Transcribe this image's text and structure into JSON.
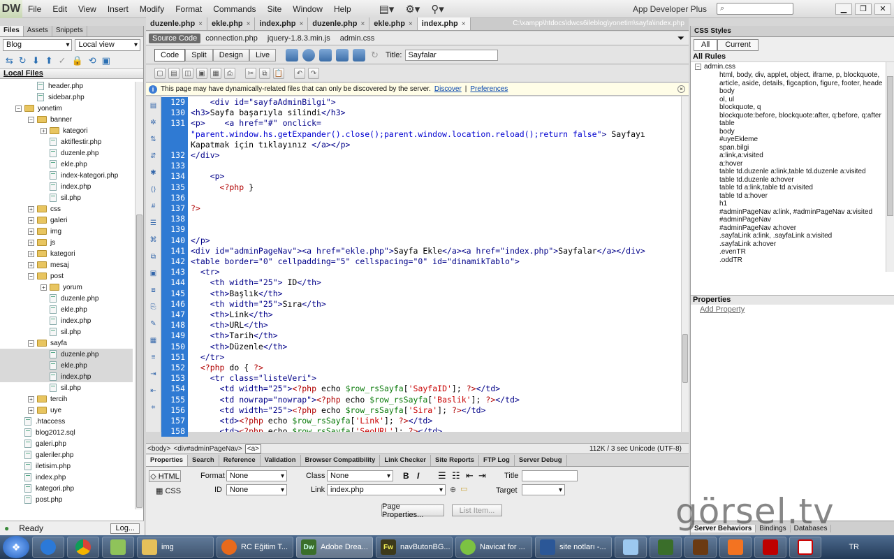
{
  "menubar": {
    "logo": "DW",
    "items": [
      "File",
      "Edit",
      "View",
      "Insert",
      "Modify",
      "Format",
      "Commands",
      "Site",
      "Window",
      "Help"
    ],
    "workspace": "App Developer Plus"
  },
  "files_panel": {
    "tabs": [
      "Files",
      "Assets",
      "Snippets"
    ],
    "site_select": "Blog",
    "view_select": "Local view",
    "header": "Local Files",
    "tree": [
      {
        "label": "header.php",
        "depth": 2,
        "type": "file"
      },
      {
        "label": "sidebar.php",
        "depth": 2,
        "type": "file"
      },
      {
        "label": "yonetim",
        "depth": 1,
        "type": "folder",
        "exp": "−"
      },
      {
        "label": "banner",
        "depth": 2,
        "type": "folder",
        "exp": "−"
      },
      {
        "label": "kategori",
        "depth": 3,
        "type": "folder",
        "exp": "+"
      },
      {
        "label": "aktiflestir.php",
        "depth": 3,
        "type": "file"
      },
      {
        "label": "duzenle.php",
        "depth": 3,
        "type": "file"
      },
      {
        "label": "ekle.php",
        "depth": 3,
        "type": "file"
      },
      {
        "label": "index-kategori.php",
        "depth": 3,
        "type": "file"
      },
      {
        "label": "index.php",
        "depth": 3,
        "type": "file"
      },
      {
        "label": "sil.php",
        "depth": 3,
        "type": "file"
      },
      {
        "label": "css",
        "depth": 2,
        "type": "folder",
        "exp": "+"
      },
      {
        "label": "galeri",
        "depth": 2,
        "type": "folder",
        "exp": "+"
      },
      {
        "label": "img",
        "depth": 2,
        "type": "folder",
        "exp": "+"
      },
      {
        "label": "js",
        "depth": 2,
        "type": "folder",
        "exp": "+"
      },
      {
        "label": "kategori",
        "depth": 2,
        "type": "folder",
        "exp": "+"
      },
      {
        "label": "mesaj",
        "depth": 2,
        "type": "folder",
        "exp": "+"
      },
      {
        "label": "post",
        "depth": 2,
        "type": "folder",
        "exp": "−"
      },
      {
        "label": "yorum",
        "depth": 3,
        "type": "folder",
        "exp": "+"
      },
      {
        "label": "duzenle.php",
        "depth": 3,
        "type": "file"
      },
      {
        "label": "ekle.php",
        "depth": 3,
        "type": "file"
      },
      {
        "label": "index.php",
        "depth": 3,
        "type": "file"
      },
      {
        "label": "sil.php",
        "depth": 3,
        "type": "file"
      },
      {
        "label": "sayfa",
        "depth": 2,
        "type": "folder",
        "exp": "−"
      },
      {
        "label": "duzenle.php",
        "depth": 3,
        "type": "file",
        "selected": true
      },
      {
        "label": "ekle.php",
        "depth": 3,
        "type": "file",
        "selected": true
      },
      {
        "label": "index.php",
        "depth": 3,
        "type": "file",
        "selected": true
      },
      {
        "label": "sil.php",
        "depth": 3,
        "type": "file"
      },
      {
        "label": "tercih",
        "depth": 2,
        "type": "folder",
        "exp": "+"
      },
      {
        "label": "uye",
        "depth": 2,
        "type": "folder",
        "exp": "+"
      },
      {
        "label": ".htaccess",
        "depth": 1,
        "type": "file"
      },
      {
        "label": "blog2012.sql",
        "depth": 1,
        "type": "file"
      },
      {
        "label": "galeri.php",
        "depth": 1,
        "type": "file"
      },
      {
        "label": "galeriler.php",
        "depth": 1,
        "type": "file"
      },
      {
        "label": "iletisim.php",
        "depth": 1,
        "type": "file"
      },
      {
        "label": "index.php",
        "depth": 1,
        "type": "file"
      },
      {
        "label": "kategori.php",
        "depth": 1,
        "type": "file"
      },
      {
        "label": "post.php",
        "depth": 1,
        "type": "file"
      }
    ],
    "status": "Ready",
    "log_button": "Log..."
  },
  "doc_tabs": [
    "duzenle.php",
    "ekle.php",
    "index.php",
    "duzenle.php",
    "ekle.php",
    "index.php"
  ],
  "doc_path": "C:\\xampp\\htdocs\\dwcs6ileblog\\yonetim\\sayfa\\index.php",
  "related_files": [
    "Source Code",
    "connection.php",
    "jquery-1.8.3.min.js",
    "admin.css"
  ],
  "view_buttons": [
    "Code",
    "Split",
    "Design",
    "Live"
  ],
  "title_label": "Title:",
  "title_value": "Sayfalar",
  "infobar": {
    "text": "This page may have dynamically-related files that can only be discovered by the server.",
    "discover": "Discover",
    "sep": "|",
    "preferences": "Preferences"
  },
  "code_lines": [
    {
      "n": "129",
      "hl": true,
      "parts": [
        [
          "tag",
          "    <div id=\"sayfaAdminBilgi\">"
        ]
      ]
    },
    {
      "n": "130",
      "hl": true,
      "parts": [
        [
          "tag",
          "<h3>"
        ],
        [
          "txt",
          "Sayfa başarıyla silindi"
        ],
        [
          "tag",
          "</h3>"
        ]
      ]
    },
    {
      "n": "131",
      "hl": true,
      "parts": [
        [
          "tag",
          "<p>"
        ],
        [
          "txt",
          "    "
        ],
        [
          "tag",
          "<a href=\"#\" onclick="
        ]
      ]
    },
    {
      "n": "",
      "hl": true,
      "parts": [
        [
          "val",
          "\"parent.window.hs.getExpander().close();parent.window.location.reload();return false\""
        ],
        [
          "tag",
          ">"
        ],
        [
          "txt",
          " Sayfayı"
        ]
      ]
    },
    {
      "n": "",
      "hl": true,
      "parts": [
        [
          "txt",
          "Kapatmak için tıklayınız "
        ],
        [
          "tag",
          "</a></p>"
        ]
      ]
    },
    {
      "n": "132",
      "hl": true,
      "parts": [
        [
          "tag",
          "</div>"
        ]
      ]
    },
    {
      "n": "133",
      "hl": true,
      "parts": [
        [
          "txt",
          ""
        ]
      ]
    },
    {
      "n": "134",
      "hl": true,
      "parts": [
        [
          "tag",
          "    <p>"
        ]
      ]
    },
    {
      "n": "135",
      "hl": true,
      "parts": [
        [
          "php",
          "      <?php "
        ],
        [
          "txt",
          "}"
        ]
      ]
    },
    {
      "n": "136",
      "hl": true,
      "parts": [
        [
          "txt",
          ""
        ]
      ]
    },
    {
      "n": "137",
      "hl": true,
      "parts": [
        [
          "php",
          "?>"
        ]
      ]
    },
    {
      "n": "138",
      "hl": true,
      "parts": [
        [
          "txt",
          ""
        ]
      ]
    },
    {
      "n": "139",
      "hl": true,
      "parts": [
        [
          "txt",
          ""
        ]
      ]
    },
    {
      "n": "140",
      "hl": true,
      "parts": [
        [
          "tag",
          "</p>"
        ]
      ]
    },
    {
      "n": "141",
      "hl": true,
      "parts": [
        [
          "tag",
          "<div id=\"adminPageNav\"><a href=\"ekle.php\">"
        ],
        [
          "txt",
          "Sayfa Ekle"
        ],
        [
          "tag",
          "</a><a href=\"index.php\">"
        ],
        [
          "txt",
          "Sayfalar"
        ],
        [
          "tag",
          "</a></div>"
        ]
      ]
    },
    {
      "n": "142",
      "hl": true,
      "parts": [
        [
          "tag",
          "<table border=\"0\" cellpadding=\"5\" cellspacing=\"0\" id=\"dinamikTablo\">"
        ]
      ]
    },
    {
      "n": "143",
      "hl": true,
      "parts": [
        [
          "tag",
          "  <tr>"
        ]
      ]
    },
    {
      "n": "144",
      "hl": true,
      "parts": [
        [
          "tag",
          "    <th width=\"25\">"
        ],
        [
          "txt",
          " ID"
        ],
        [
          "tag",
          "</th>"
        ]
      ]
    },
    {
      "n": "145",
      "hl": true,
      "parts": [
        [
          "tag",
          "    <th>"
        ],
        [
          "txt",
          "Başlık"
        ],
        [
          "tag",
          "</th>"
        ]
      ]
    },
    {
      "n": "146",
      "hl": true,
      "parts": [
        [
          "tag",
          "    <th width=\"25\">"
        ],
        [
          "txt",
          "Sıra"
        ],
        [
          "tag",
          "</th>"
        ]
      ]
    },
    {
      "n": "147",
      "hl": true,
      "parts": [
        [
          "tag",
          "    <th>"
        ],
        [
          "txt",
          "Link"
        ],
        [
          "tag",
          "</th>"
        ]
      ]
    },
    {
      "n": "148",
      "hl": true,
      "parts": [
        [
          "tag",
          "    <th>"
        ],
        [
          "txt",
          "URL"
        ],
        [
          "tag",
          "</th>"
        ]
      ]
    },
    {
      "n": "149",
      "hl": true,
      "parts": [
        [
          "tag",
          "    <th>"
        ],
        [
          "txt",
          "Tarih"
        ],
        [
          "tag",
          "</th>"
        ]
      ]
    },
    {
      "n": "150",
      "hl": true,
      "parts": [
        [
          "tag",
          "    <th>"
        ],
        [
          "txt",
          "Düzenle"
        ],
        [
          "tag",
          "</th>"
        ]
      ]
    },
    {
      "n": "151",
      "hl": true,
      "parts": [
        [
          "tag",
          "  </tr>"
        ]
      ]
    },
    {
      "n": "152",
      "hl": true,
      "parts": [
        [
          "php",
          "  <?php "
        ],
        [
          "txt",
          "do { "
        ],
        [
          "php",
          "?>"
        ]
      ]
    },
    {
      "n": "153",
      "hl": true,
      "parts": [
        [
          "tag",
          "    <tr class=\"listeVeri\">"
        ]
      ]
    },
    {
      "n": "154",
      "hl": true,
      "parts": [
        [
          "tag",
          "      <td width=\"25\">"
        ],
        [
          "php",
          "<?php "
        ],
        [
          "txt",
          "echo "
        ],
        [
          "var",
          "$row_rsSayfa"
        ],
        [
          "txt",
          "["
        ],
        [
          "str",
          "'SayfaID'"
        ],
        [
          "txt",
          "]; "
        ],
        [
          "php",
          "?>"
        ],
        [
          "tag",
          "</td>"
        ]
      ]
    },
    {
      "n": "155",
      "hl": true,
      "parts": [
        [
          "tag",
          "      <td nowrap=\"nowrap\">"
        ],
        [
          "php",
          "<?php "
        ],
        [
          "txt",
          "echo "
        ],
        [
          "var",
          "$row_rsSayfa"
        ],
        [
          "txt",
          "["
        ],
        [
          "str",
          "'Baslik'"
        ],
        [
          "txt",
          "]; "
        ],
        [
          "php",
          "?>"
        ],
        [
          "tag",
          "</td>"
        ]
      ]
    },
    {
      "n": "156",
      "hl": true,
      "parts": [
        [
          "tag",
          "      <td width=\"25\">"
        ],
        [
          "php",
          "<?php "
        ],
        [
          "txt",
          "echo "
        ],
        [
          "var",
          "$row_rsSayfa"
        ],
        [
          "txt",
          "["
        ],
        [
          "str",
          "'Sira'"
        ],
        [
          "txt",
          "]; "
        ],
        [
          "php",
          "?>"
        ],
        [
          "tag",
          "</td>"
        ]
      ]
    },
    {
      "n": "157",
      "hl": true,
      "parts": [
        [
          "tag",
          "      <td>"
        ],
        [
          "php",
          "<?php "
        ],
        [
          "txt",
          "echo "
        ],
        [
          "var",
          "$row_rsSayfa"
        ],
        [
          "txt",
          "["
        ],
        [
          "str",
          "'Link'"
        ],
        [
          "txt",
          "]; "
        ],
        [
          "php",
          "?>"
        ],
        [
          "tag",
          "</td>"
        ]
      ]
    },
    {
      "n": "158",
      "hl": true,
      "parts": [
        [
          "tag",
          "      <td>"
        ],
        [
          "php",
          "<?php "
        ],
        [
          "txt",
          "echo "
        ],
        [
          "var",
          "$row_rsSayfa"
        ],
        [
          "txt",
          "["
        ],
        [
          "str",
          "'SeoURL'"
        ],
        [
          "txt",
          "]; "
        ],
        [
          "php",
          "?>"
        ],
        [
          "tag",
          "</td>"
        ]
      ]
    }
  ],
  "status_bar": {
    "tags": [
      "<body>",
      "<div#adminPageNav>",
      "<a>"
    ],
    "info": "112K / 3 sec  Unicode (UTF-8)"
  },
  "prop_tabs": [
    "Properties",
    "Search",
    "Reference",
    "Validation",
    "Browser Compatibility",
    "Link Checker",
    "Site Reports",
    "FTP Log",
    "Server Debug"
  ],
  "properties": {
    "html_btn": "HTML",
    "css_btn": "CSS",
    "format_label": "Format",
    "format_value": "None",
    "id_label": "ID",
    "id_value": "None",
    "class_label": "Class",
    "class_value": "None",
    "link_label": "Link",
    "link_value": "index.php",
    "title_label": "Title",
    "target_label": "Target",
    "bold": "B",
    "italic": "I",
    "page_props": "Page Properties...",
    "list_item": "List Item..."
  },
  "css_panel": {
    "title": "CSS Styles",
    "tabs": [
      "All",
      "Current"
    ],
    "all_rules": "All Rules",
    "sheet": "admin.css",
    "rules": [
      "html, body, div, applet, object, iframe, p, blockquote,",
      "article, aside, details, figcaption, figure, footer, heade",
      "body",
      "ol, ul",
      "blockquote, q",
      "blockquote:before, blockquote:after, q:before, q:after",
      "table",
      "body",
      "#uyeEkleme",
      "span.bilgi",
      "a:link,a:visited",
      "a:hover",
      "table td.duzenle a:link,table td.duzenle a:visited",
      "table td.duzenle a:hover",
      "table td a:link,table td a:visited",
      "table td a:hover",
      "h1",
      "#adminPageNav a:link, #adminPageNav a:visited",
      "#adminPageNav",
      "#adminPageNav a:hover",
      ".sayfaLink a:link, .sayfaLink a:visited",
      ".sayfaLink a:hover",
      ".evenTR",
      ".oddTR"
    ],
    "properties_header": "Properties",
    "add_property": "Add Property",
    "bottom_tabs": [
      "Server Behaviors",
      "Bindings",
      "Databases"
    ]
  },
  "watermark": "görsel.tv",
  "taskbar": {
    "tasks": [
      "img",
      "RC Eğitim T...",
      "Adobe Drea...",
      "navButonBG...",
      "Navicat for ...",
      "site notları -..."
    ],
    "lang": "TR"
  }
}
